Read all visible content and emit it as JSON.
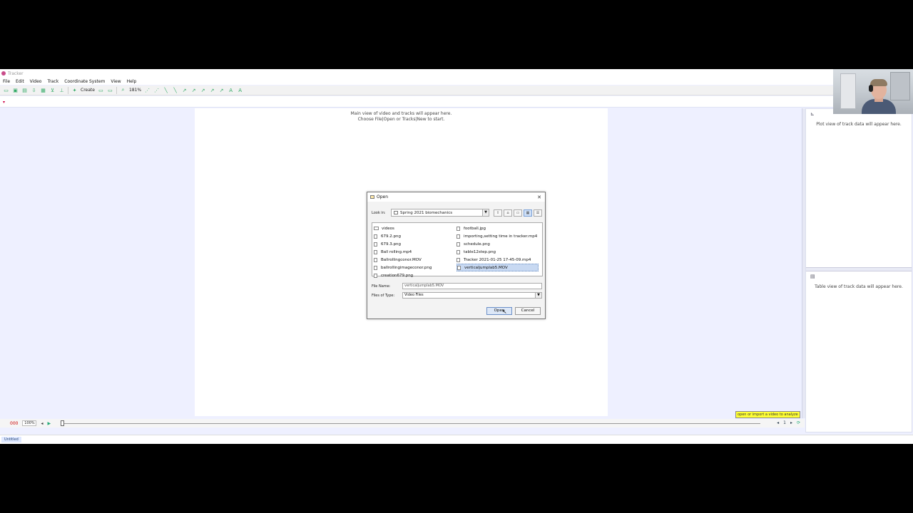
{
  "app": {
    "title": "Tracker",
    "menu": [
      "File",
      "Edit",
      "Video",
      "Track",
      "Coordinate System",
      "View",
      "Help"
    ],
    "toolbar": {
      "create_label": "Create",
      "zoom_label": "181%"
    }
  },
  "main_view": {
    "hint_line1": "Main view of video and tracks will appear here.",
    "hint_line2": "Choose File|Open or Tracks|New to start."
  },
  "right_panel": {
    "plot_hint": "Plot view of track data will appear here.",
    "table_hint": "Table view of track data will appear here."
  },
  "player": {
    "frame": "000",
    "zoom": "100%",
    "import_tip": "open or import a video to analyze"
  },
  "status": {
    "tab_label": "Untitled"
  },
  "dialog": {
    "title": "Open",
    "look_in_label": "Look in:",
    "look_in_value": "Spring 2021 biomechanics",
    "files_left": [
      {
        "name": "videos",
        "type": "folder"
      },
      {
        "name": "679.2.png",
        "type": "file"
      },
      {
        "name": "679.3.png",
        "type": "file"
      },
      {
        "name": "Ball rolling.mp4",
        "type": "file"
      },
      {
        "name": "Ballrollingconor.MOV",
        "type": "file"
      },
      {
        "name": "ballrollingimageconor.png",
        "type": "file"
      },
      {
        "name": "creation679.png",
        "type": "file"
      }
    ],
    "files_right": [
      {
        "name": "football.jpg",
        "type": "file"
      },
      {
        "name": "importing,setting time in tracker.mp4",
        "type": "file"
      },
      {
        "name": "schedule.png",
        "type": "file"
      },
      {
        "name": "table12step.png",
        "type": "file"
      },
      {
        "name": "Tracker 2021-01-25 17-45-09.mp4",
        "type": "file"
      },
      {
        "name": "verticaljumplab5.MOV",
        "type": "file",
        "selected": true
      }
    ],
    "file_name_label": "File Name:",
    "file_name_value": "verticaljumplab5.MOV",
    "files_of_type_label": "Files of Type:",
    "files_of_type_value": "Video Files",
    "open_label": "Open",
    "cancel_label": "Cancel"
  }
}
